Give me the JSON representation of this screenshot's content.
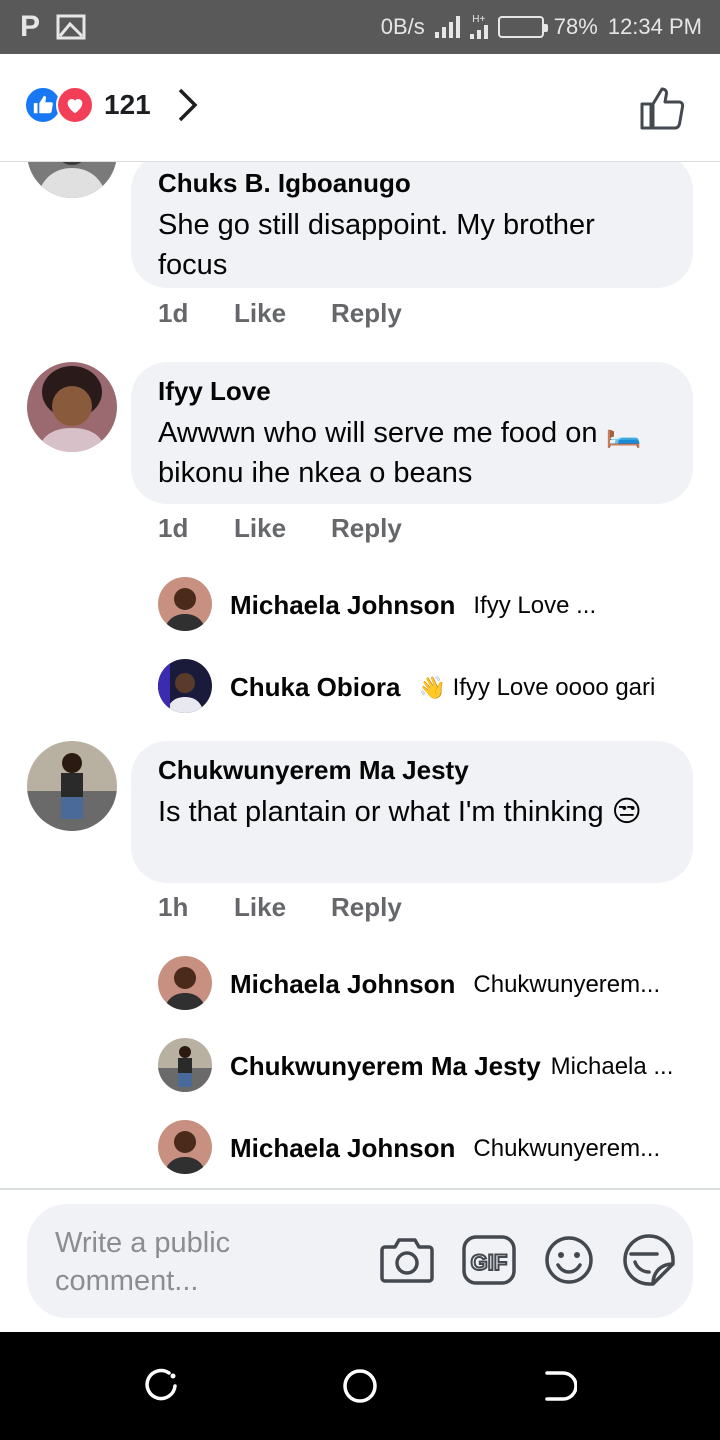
{
  "status_bar": {
    "speed": "0B/s",
    "battery": "78%",
    "battery_level": 0.78,
    "time": "12:34 PM",
    "network": "H+",
    "icons": [
      "p-icon",
      "image-icon",
      "signal-icon",
      "battery-icon"
    ]
  },
  "header": {
    "reaction_count": "121",
    "reactions": [
      "like",
      "love"
    ]
  },
  "comments": [
    {
      "author": "Chuks B. Igboanugo",
      "text": "She go still disappoint. My brother focus",
      "time": "1d",
      "like": "Like",
      "reply": "Reply"
    },
    {
      "author": "Ifyy Love",
      "emoji": "🛏️",
      "text": "bikonu ihe nkea o beans",
      "text_prefix": "Awwwn who will serve me food on",
      "time": "1d",
      "like": "Like",
      "reply": "Reply",
      "replies": [
        {
          "author": "Michaela Johnson",
          "text": "Ifyy Love ..."
        },
        {
          "author": "Chuka Obiora",
          "emoji": "👋",
          "text": "Ifyy Love oooo gari"
        }
      ]
    },
    {
      "author": "Chukwunyerem Ma Jesty",
      "text": "Is that plantain or what I'm thinking",
      "emoji": "😒",
      "time": "1h",
      "like": "Like",
      "reply": "Reply",
      "replies": [
        {
          "author": "Michaela Johnson",
          "text": "Chukwunyerem..."
        },
        {
          "author": "Chukwunyerem Ma Jesty",
          "text": "Michaela ..."
        },
        {
          "author": "Michaela Johnson",
          "text": "Chukwunyerem..."
        }
      ]
    }
  ],
  "composer": {
    "placeholder": "Write a public comment...",
    "icons": [
      "camera-icon",
      "gif-icon",
      "emoji-icon",
      "sticker-icon"
    ]
  },
  "colors": {
    "status_bar": "#595959",
    "bubble": "#f0f2f5",
    "meta_text": "#65676b",
    "like_blue": "#1877f2",
    "love_red": "#f33e58"
  }
}
